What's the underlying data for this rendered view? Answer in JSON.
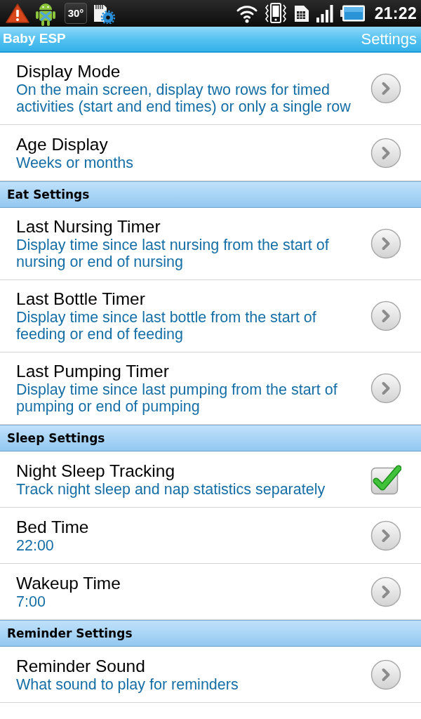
{
  "status_bar": {
    "temperature": "30°",
    "time": "21:22"
  },
  "app_bar": {
    "title": "Baby ESP",
    "screen": "Settings"
  },
  "items": [
    {
      "kind": "preference",
      "title": "Display Mode",
      "summary": "On the main screen, display two rows for timed activities (start and end times) or only a single row"
    },
    {
      "kind": "preference",
      "title": "Age Display",
      "summary": "Weeks or months"
    },
    {
      "kind": "header",
      "title": "Eat Settings"
    },
    {
      "kind": "preference",
      "title": "Last Nursing Timer",
      "summary": "Display time since last nursing from the start of nursing or end of nursing"
    },
    {
      "kind": "preference",
      "title": "Last Bottle Timer",
      "summary": "Display time since last bottle from the start of feeding or end of feeding"
    },
    {
      "kind": "preference",
      "title": "Last Pumping Timer",
      "summary": "Display time since last pumping from the start of pumping or end of pumping"
    },
    {
      "kind": "header",
      "title": "Sleep Settings"
    },
    {
      "kind": "checkbox",
      "title": "Night Sleep Tracking",
      "summary": "Track night sleep and nap statistics separately",
      "checked": true
    },
    {
      "kind": "preference",
      "title": "Bed Time",
      "summary": "22:00"
    },
    {
      "kind": "preference",
      "title": "Wakeup Time",
      "summary": "7:00"
    },
    {
      "kind": "header",
      "title": "Reminder Settings"
    },
    {
      "kind": "preference",
      "title": "Reminder Sound",
      "summary": "What sound to play for reminders"
    }
  ]
}
